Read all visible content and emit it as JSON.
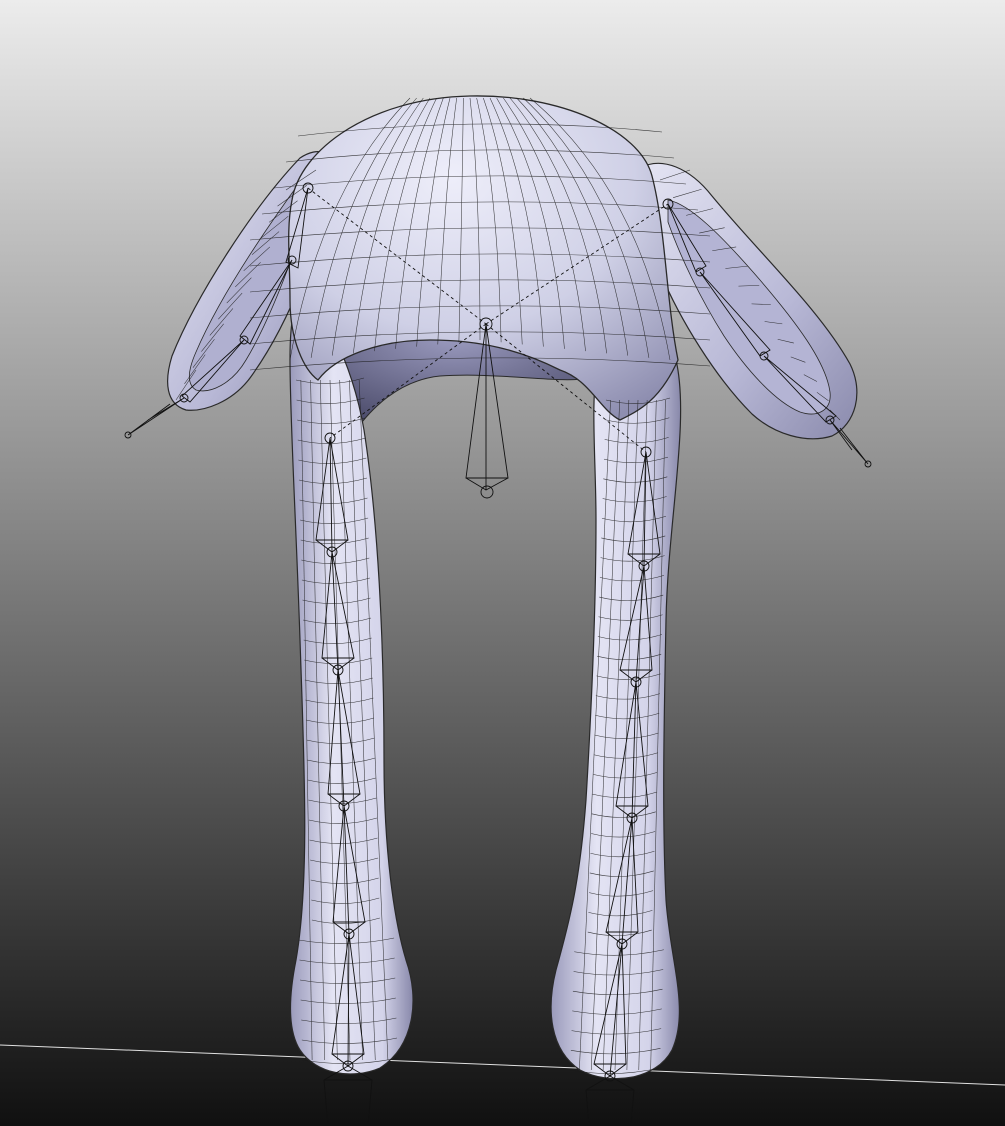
{
  "viewport": {
    "kind": "3d-modeling-viewport",
    "display_mode": "shaded-with-wireframe",
    "subject": "rigged-hat-mesh-with-bones",
    "colors": {
      "bg_top": "#ececec",
      "bg_bottom": "#101010",
      "mesh_light": "#e8e8f6",
      "mesh_mid": "#c2c2de",
      "mesh_dark": "#6e6e94",
      "wire": "#1b1b1b",
      "bone": "#111111",
      "ground_line": "#e0e0e0"
    }
  }
}
